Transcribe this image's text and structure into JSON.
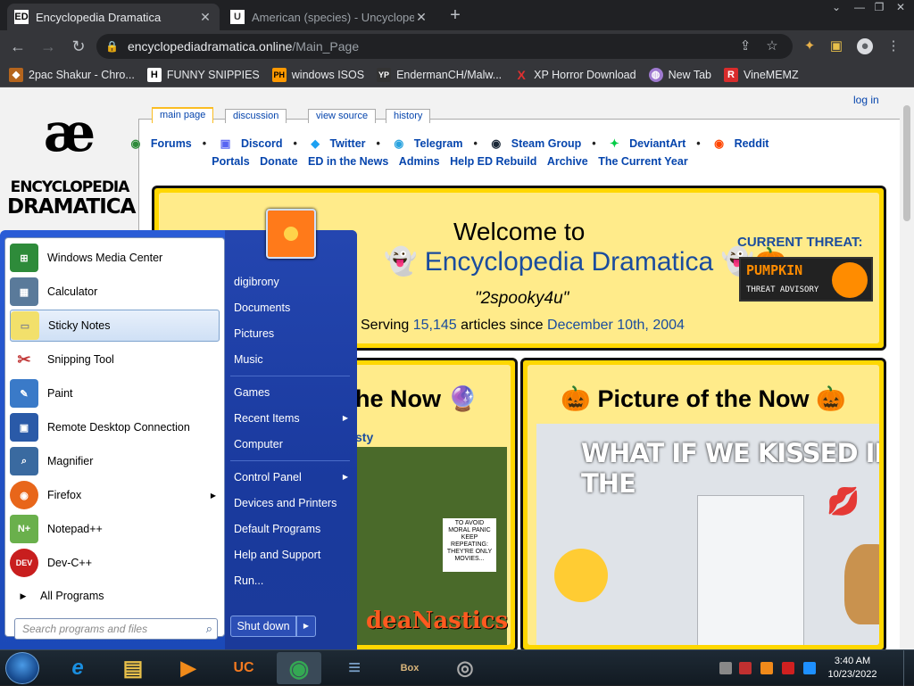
{
  "browser": {
    "tabs": [
      {
        "title": "Encyclopedia Dramatica",
        "favicon": "ED",
        "active": true
      },
      {
        "title": "American (species) - Uncyclopedia",
        "favicon": "U",
        "active": false
      }
    ],
    "url_host": "encyclopediadramatica.online",
    "url_path": "/Main_Page"
  },
  "bookmarks": [
    {
      "label": "2pac Shakur - Chro...",
      "icon": "bookmark-icon",
      "color": "#b5651d"
    },
    {
      "label": "FUNNY SNIPPIES",
      "icon": "H",
      "color": "#ffffff"
    },
    {
      "label": "windows ISOS",
      "icon": "PH",
      "color": "#ff9900"
    },
    {
      "label": "EndermanCH/Malw...",
      "icon": "YP",
      "color": "#333333"
    },
    {
      "label": "XP Horror Download",
      "icon": "X",
      "color": "#e03030"
    },
    {
      "label": "New Tab",
      "icon": "globe-icon",
      "color": "#9f7ad0"
    },
    {
      "label": "VineMEMZ",
      "icon": "R",
      "color": "#d92c2c"
    }
  ],
  "logo": {
    "symbol": "æ",
    "line1": "ENCYCLOPEDIA",
    "line2": "DRAMATICA"
  },
  "page_tabs": [
    "main page",
    "discussion",
    "view source",
    "history"
  ],
  "login": "log in",
  "links_row1": [
    "Forums",
    "Discord",
    "Twitter",
    "Telegram",
    "Steam Group",
    "DeviantArt",
    "Reddit"
  ],
  "links_row2": [
    "Portals",
    "Donate",
    "ED in the News",
    "Admins",
    "Help ED Rebuild",
    "Archive",
    "The Current Year"
  ],
  "welcome": {
    "line1": "Welcome to",
    "line2": "Encyclopedia Dramatica",
    "motto": "\"2spooky4u\"",
    "serving_prefix": "Serving",
    "articles": "15,145",
    "serving_mid": "articles since",
    "since": "December 10th, 2004",
    "threat_label": "CURRENT THREAT:",
    "threat_word": "PUMPKIN",
    "threat_sub": "THREAT ADVISORY"
  },
  "now_box": {
    "title_fragment": "he Now",
    "link_fragment": "sty",
    "poster_text": "TO AVOID MORAL PANIC KEEP REPEATING: THEY'RE ONLY MOVIES...",
    "poster_title": "deaNastics"
  },
  "picture_box": {
    "title": "Picture of the Now",
    "caption": "WHAT IF WE KISSED IN THE"
  },
  "start_menu": {
    "user": "digibrony",
    "left_items": [
      {
        "label": "Windows Media Center",
        "color": "#2e8b3a",
        "arrow": false
      },
      {
        "label": "Calculator",
        "color": "#5a7a9a",
        "arrow": false
      },
      {
        "label": "Sticky Notes",
        "color": "#f2e06b",
        "arrow": false
      },
      {
        "label": "Snipping Tool",
        "color": "#c23a3a",
        "arrow": false
      },
      {
        "label": "Paint",
        "color": "#3a7ac8",
        "arrow": false
      },
      {
        "label": "Remote Desktop Connection",
        "color": "#2a5aa8",
        "arrow": false
      },
      {
        "label": "Magnifier",
        "color": "#3a6aa0",
        "arrow": false
      },
      {
        "label": "Firefox",
        "color": "#e8661a",
        "arrow": true
      },
      {
        "label": "Notepad++",
        "color": "#6ab04c",
        "arrow": false
      },
      {
        "label": "Dev-C++",
        "color": "#c81e1e",
        "arrow": false
      }
    ],
    "all_programs": "All Programs",
    "search_placeholder": "Search programs and files",
    "right_items": [
      {
        "label": "digibrony",
        "arrow": false
      },
      {
        "label": "Documents",
        "arrow": false
      },
      {
        "label": "Pictures",
        "arrow": false
      },
      {
        "label": "Music",
        "arrow": false
      },
      {
        "label": "Games",
        "arrow": false
      },
      {
        "label": "Recent Items",
        "arrow": true
      },
      {
        "label": "Computer",
        "arrow": false
      },
      {
        "label": "Control Panel",
        "arrow": true
      },
      {
        "label": "Devices and Printers",
        "arrow": false
      },
      {
        "label": "Default Programs",
        "arrow": false
      },
      {
        "label": "Help and Support",
        "arrow": false
      },
      {
        "label": "Run...",
        "arrow": false
      }
    ],
    "shutdown": "Shut down"
  },
  "taskbar": {
    "apps": [
      {
        "name": "internet-explorer-icon",
        "glyph": "e",
        "color": "#1a8fe0"
      },
      {
        "name": "file-explorer-icon",
        "glyph": "▤",
        "color": "#e8c04a"
      },
      {
        "name": "media-player-icon",
        "glyph": "▶",
        "color": "#f08a1a"
      },
      {
        "name": "uc-browser-icon",
        "glyph": "UC",
        "color": "#f47a20"
      },
      {
        "name": "chrome-icon",
        "glyph": "◉",
        "color": "#34a853"
      },
      {
        "name": "document-app-icon",
        "glyph": "≡",
        "color": "#7aa0c8"
      },
      {
        "name": "bonzi-box-icon",
        "glyph": "Box",
        "color": "#8a6a3a"
      },
      {
        "name": "jar-app-icon",
        "glyph": "◎",
        "color": "#888888"
      }
    ],
    "time": "3:40 AM",
    "date": "10/23/2022"
  }
}
